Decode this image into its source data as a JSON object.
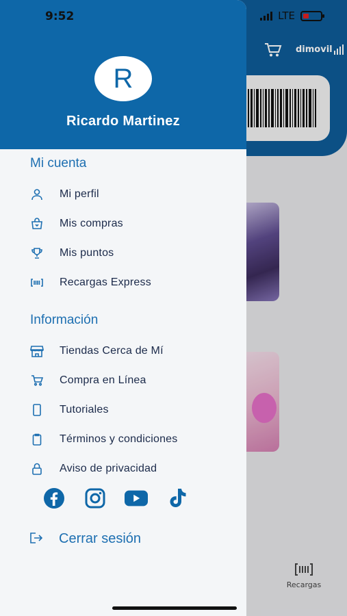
{
  "status_bar": {
    "time": "9:52",
    "network": "LTE"
  },
  "background_app": {
    "brand": "dimovil",
    "tab_recargas_label": "Recargas",
    "icons": [
      "cart-icon",
      "barcode-icon",
      "recargas-icon"
    ]
  },
  "drawer": {
    "avatar_initial": "R",
    "user_name": "Ricardo Martinez",
    "section_account": "Mi cuenta",
    "account_items": [
      {
        "label": "Mi perfil",
        "icon": "user-icon"
      },
      {
        "label": "Mis compras",
        "icon": "shopping-bag-icon"
      },
      {
        "label": "Mis puntos",
        "icon": "trophy-icon"
      },
      {
        "label": "Recargas Express",
        "icon": "barcode-icon"
      }
    ],
    "section_info": "Información",
    "info_items": [
      {
        "label": "Tiendas Cerca de Mí",
        "icon": "store-icon"
      },
      {
        "label": "Compra en Línea",
        "icon": "cart-icon"
      },
      {
        "label": "Tutoriales",
        "icon": "phone-icon"
      },
      {
        "label": "Términos y condiciones",
        "icon": "clipboard-icon"
      },
      {
        "label": "Aviso de privacidad",
        "icon": "lock-icon"
      }
    ],
    "social": [
      "facebook-icon",
      "instagram-icon",
      "youtube-icon",
      "tiktok-icon"
    ],
    "logout_label": "Cerrar sesión"
  },
  "colors": {
    "primary": "#0e67a8",
    "accent": "#1d6fb1",
    "text": "#1b2a4a",
    "drawer_bg": "#f4f6f8"
  }
}
